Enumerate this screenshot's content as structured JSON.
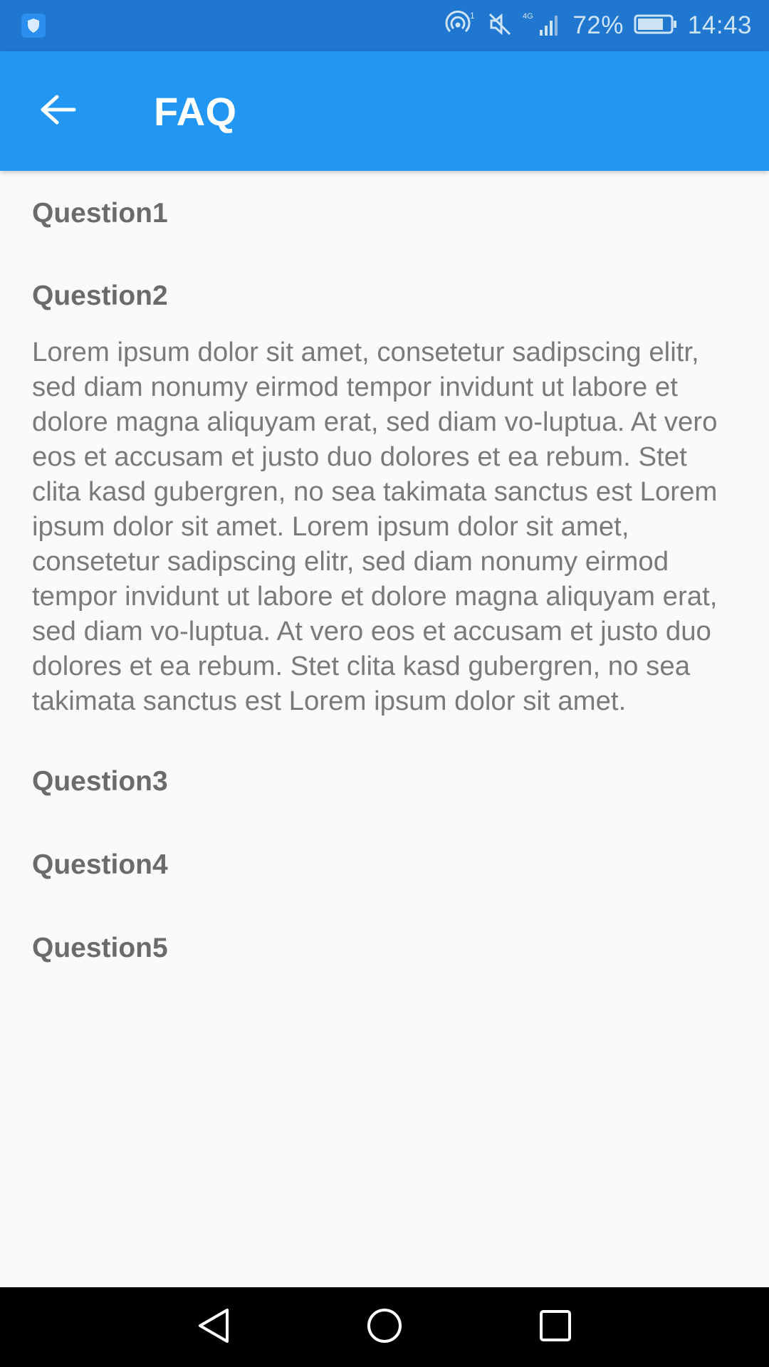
{
  "status_bar": {
    "battery_percent": "72%",
    "time": "14:43",
    "network": "4G",
    "hotspot_count": "1"
  },
  "app_bar": {
    "title": "FAQ",
    "back_icon": "arrow-back-icon"
  },
  "faq": {
    "items": [
      {
        "question": "Question1",
        "answer": ""
      },
      {
        "question": "Question2",
        "answer": "Lorem ipsum dolor sit amet, consetetur sadipscing elitr, sed diam nonumy eirmod tempor invidunt ut labore et dolore magna aliquyam erat, sed diam vo-luptua. At vero eos et accusam et justo duo dolores et ea rebum. Stet clita kasd gubergren, no sea takimata sanctus est Lorem ipsum dolor sit amet. Lorem ipsum dolor sit amet, consetetur sadipscing elitr, sed diam nonumy eirmod tempor invidunt ut labore et dolore magna aliquyam erat, sed diam vo-luptua. At vero eos et accusam et justo duo dolores et ea rebum. Stet clita kasd gubergren, no sea takimata sanctus est Lorem ipsum dolor sit amet."
      },
      {
        "question": "Question3",
        "answer": ""
      },
      {
        "question": "Question4",
        "answer": ""
      },
      {
        "question": "Question5",
        "answer": ""
      }
    ]
  },
  "colors": {
    "status_bar": "#1f77d0",
    "app_bar": "#2196f3",
    "background": "#fafafa",
    "question_text": "#6b6b6b",
    "answer_text": "#7a7a7a",
    "nav_bar": "#000000"
  },
  "nav_bar": {
    "back_icon": "triangle-back-icon",
    "home_icon": "circle-home-icon",
    "recents_icon": "square-recents-icon"
  }
}
